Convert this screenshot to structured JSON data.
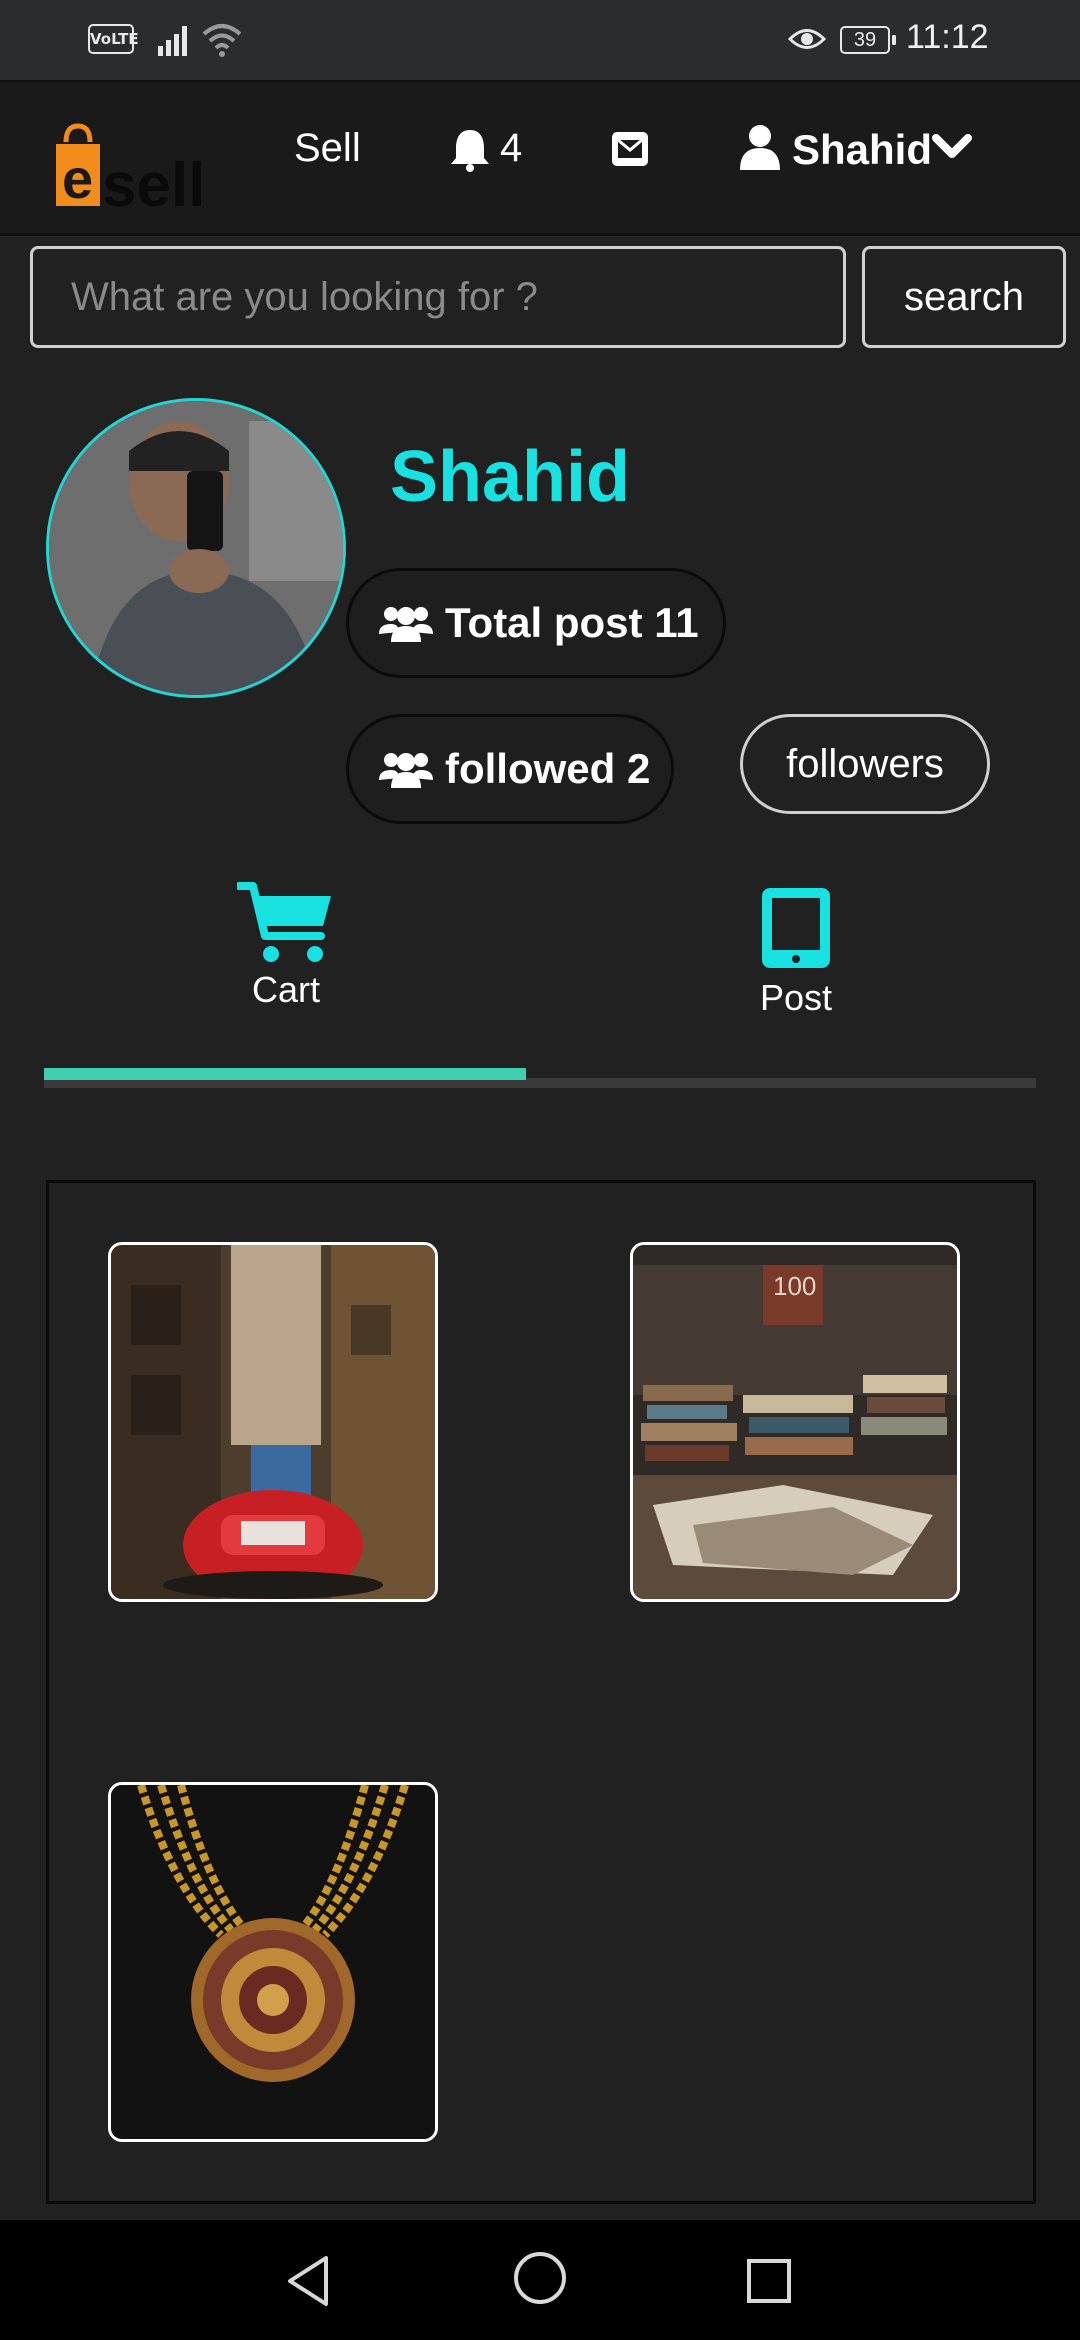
{
  "status_bar": {
    "network_badge": "VoLTE",
    "battery": "39",
    "time": "11:12"
  },
  "header": {
    "logo_text": "esell",
    "sell_label": "Sell",
    "notification_count": "4",
    "username": "Shahid"
  },
  "search": {
    "placeholder": "What are you looking for ?",
    "button_label": "search"
  },
  "profile": {
    "name": "Shahid",
    "total_post_label": "Total post 11",
    "followed_label": "followed 2",
    "followers_label": "followers"
  },
  "tabs": [
    {
      "label": "Cart",
      "icon": "cart-icon",
      "active": true
    },
    {
      "label": "Post",
      "icon": "tablet-icon",
      "active": false
    }
  ],
  "cart_items": [
    {
      "description": "red car in street photo"
    },
    {
      "description": "stack of books photo"
    },
    {
      "description": "gold necklace photo"
    }
  ],
  "colors": {
    "accent_cyan": "#17e1e1",
    "tab_indicator": "#3dcfb0",
    "logo_orange": "#f28c1a",
    "background": "#212121"
  }
}
